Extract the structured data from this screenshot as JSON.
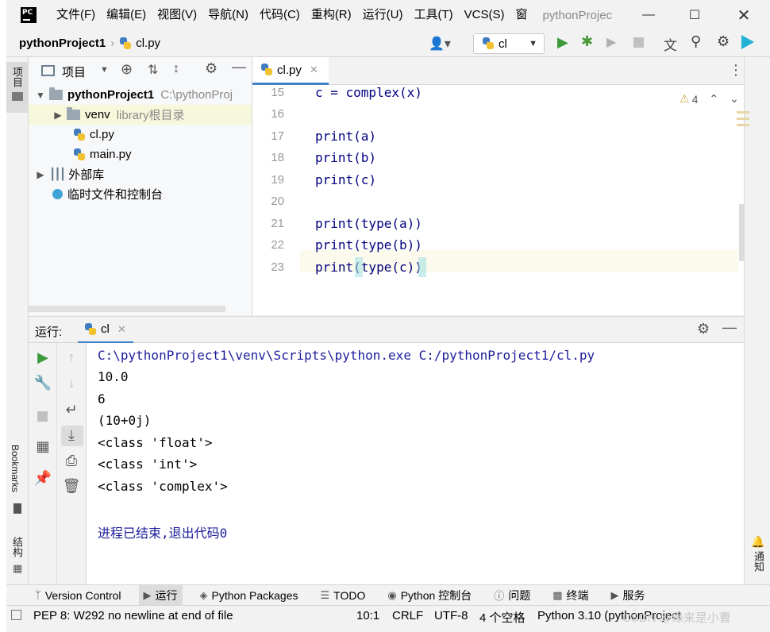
{
  "app": {
    "menu": [
      "文件(F)",
      "编辑(E)",
      "视图(V)",
      "导航(N)",
      "代码(C)",
      "重构(R)",
      "运行(U)",
      "工具(T)",
      "VCS(S)",
      "窗"
    ],
    "project_title": "pythonProjec"
  },
  "navbar": {
    "project": "pythonProject1",
    "file": "cl.py",
    "run_config": "cl"
  },
  "side": {
    "left_top_tab": "项目",
    "bookmarks": "Bookmarks",
    "structure": "结构",
    "right_tab": "通知"
  },
  "project_panel": {
    "title": "项目",
    "tree": [
      {
        "label": "pythonProject1",
        "hint": "C:\\pythonProj"
      },
      {
        "label": "venv",
        "hint": "library根目录"
      },
      {
        "label": "cl.py"
      },
      {
        "label": "main.py"
      },
      {
        "label": "外部库"
      },
      {
        "label": "临时文件和控制台"
      }
    ]
  },
  "editor": {
    "tab": "cl.py",
    "warnings": "4",
    "lines": [
      {
        "n": "15",
        "code": "c = complex(x)"
      },
      {
        "n": "16",
        "code": ""
      },
      {
        "n": "17",
        "code": "print(a)"
      },
      {
        "n": "18",
        "code": "print(b)"
      },
      {
        "n": "19",
        "code": "print(c)"
      },
      {
        "n": "20",
        "code": ""
      },
      {
        "n": "21",
        "code": "print(type(a))"
      },
      {
        "n": "22",
        "code": "print(type(b))"
      },
      {
        "n": "23",
        "code": "print(type(c))"
      }
    ]
  },
  "run": {
    "label": "运行:",
    "tab": "cl",
    "output": [
      "C:\\pythonProject1\\venv\\Scripts\\python.exe C:/pythonProject1/cl.py",
      "10.0",
      "6",
      "(10+0j)",
      "<class 'float'>",
      "<class 'int'>",
      "<class 'complex'>",
      "",
      "进程已结束,退出代码0"
    ]
  },
  "toolwindows": [
    "Version Control",
    "运行",
    "Python Packages",
    "TODO",
    "Python 控制台",
    "问题",
    "终端",
    "服务"
  ],
  "status": {
    "message": "PEP 8: W292 no newline at end of file",
    "position": "10:1",
    "line_sep": "CRLF",
    "encoding": "UTF-8",
    "indent": "4 个空格",
    "interpreter": "Python 3.10 (pythonProject",
    "watermark": "CSDN @缘来是小曹"
  }
}
